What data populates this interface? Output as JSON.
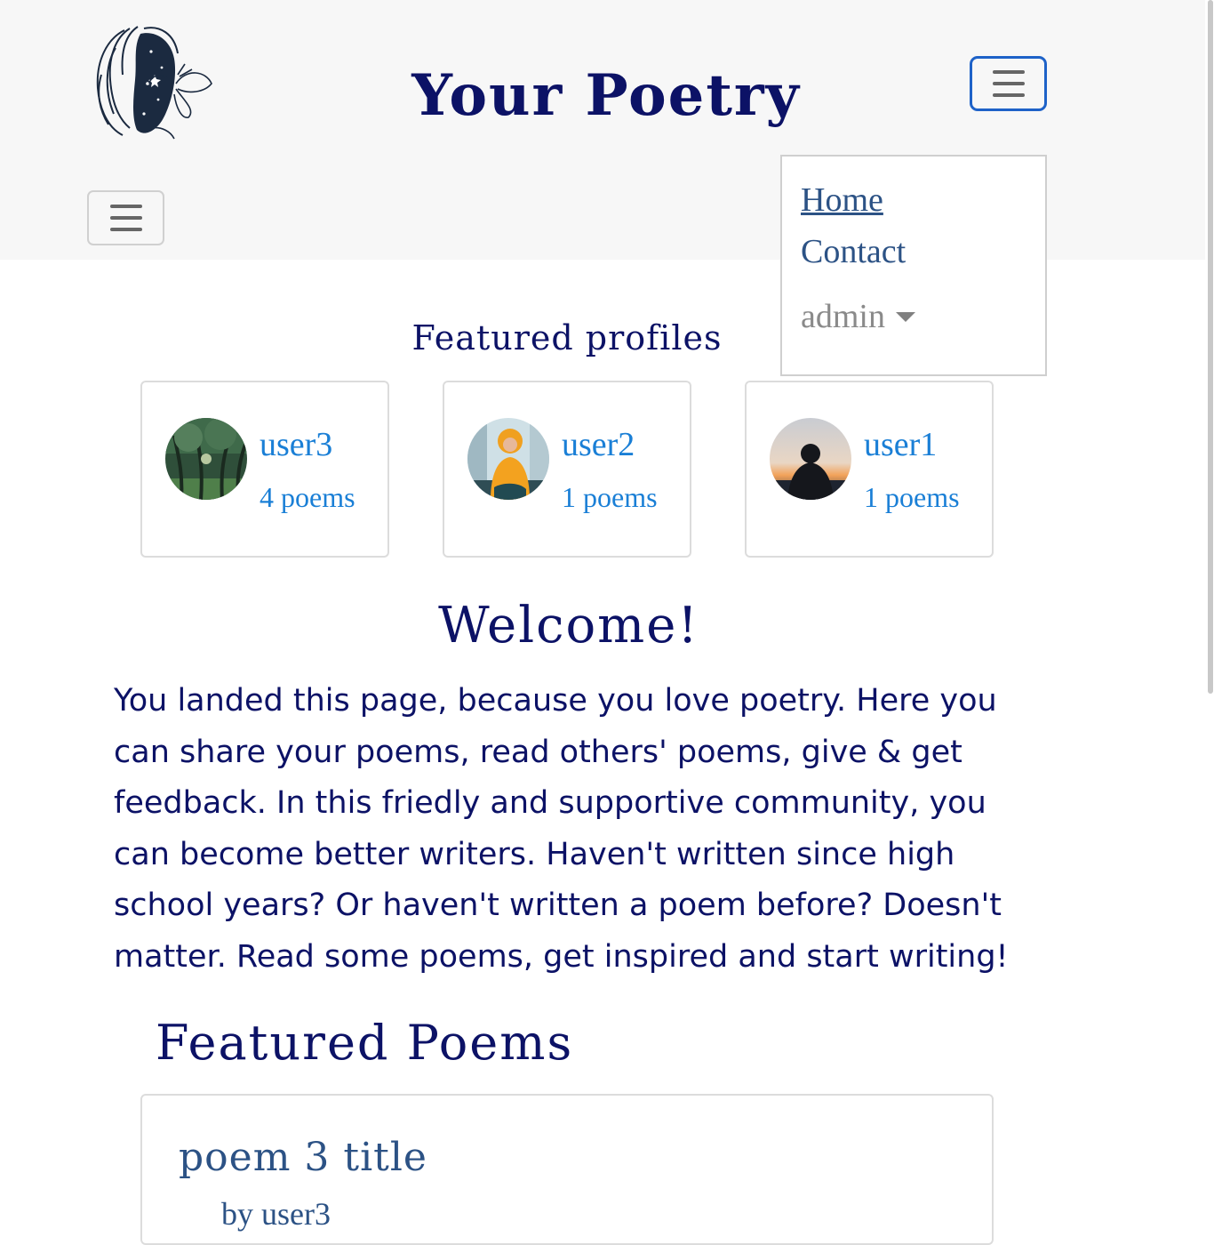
{
  "header": {
    "title": "Your Poetry",
    "logo_icon": "butterfly-woman-logo-icon",
    "menu_toggle_icon": "hamburger-icon"
  },
  "nav_menu": {
    "items": [
      {
        "label": "Home"
      },
      {
        "label": "Contact"
      },
      {
        "label": "admin"
      }
    ]
  },
  "featured_profiles": {
    "heading": "Featured profiles",
    "profiles": [
      {
        "name": "user3",
        "poems": "4 poems"
      },
      {
        "name": "user2",
        "poems": "1 poems"
      },
      {
        "name": "user1",
        "poems": "1 poems"
      }
    ]
  },
  "welcome": {
    "heading": "Welcome!",
    "text": "You landed this page, because you love poetry. Here you can share your poems, read others' poems, give & get feedback. In this friedly and supportive community, you can become better writers. Haven't written since high school years? Or haven't written a poem before? Doesn't matter. Read some poems, get inspired and start writing!"
  },
  "featured_poems": {
    "heading": "Featured Poems",
    "poems": [
      {
        "title": "poem 3 title",
        "author": "by user3"
      }
    ]
  },
  "colors": {
    "navy": "#0c1266",
    "link_blue": "#1a7fd6",
    "muted_blue": "#2c5285",
    "header_bg": "#f7f7f7",
    "toggle_border": "#1e62c8"
  }
}
